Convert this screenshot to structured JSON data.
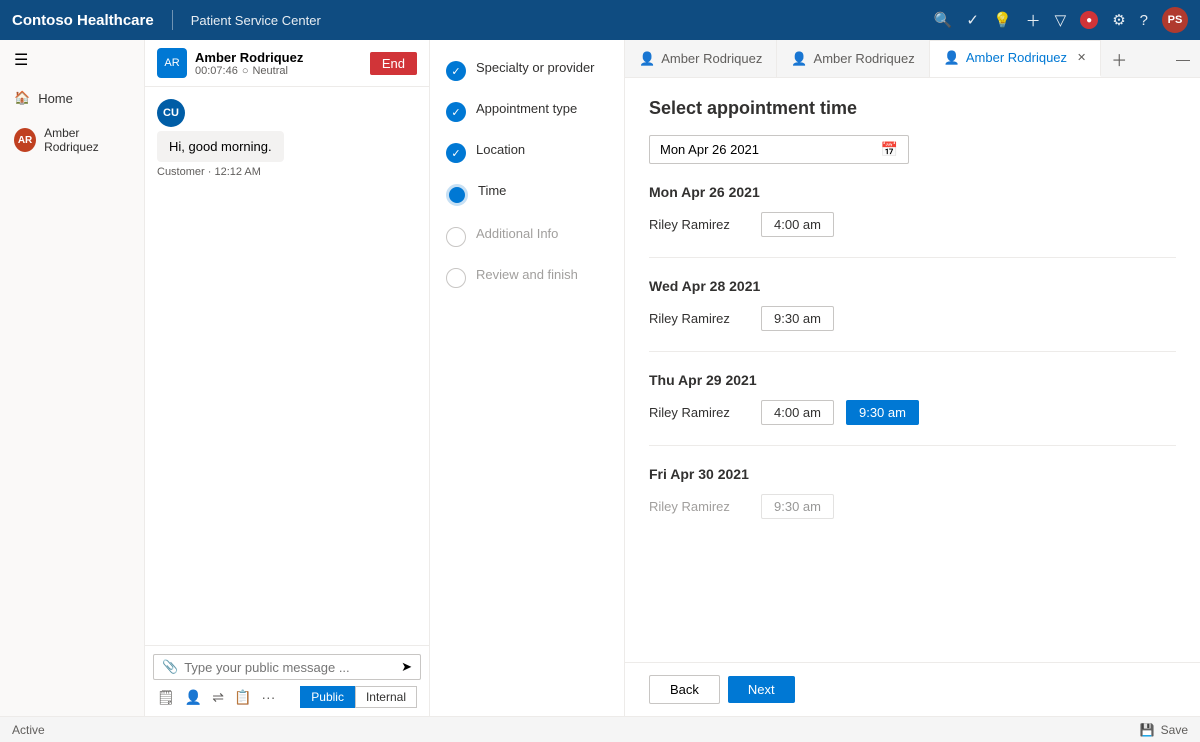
{
  "topbar": {
    "logo": "Contoso Healthcare",
    "subtitle": "Patient Service Center",
    "icons": [
      "search",
      "check-circle",
      "lightbulb",
      "plus",
      "filter",
      "notification",
      "settings",
      "help"
    ],
    "avatar_label": "PS"
  },
  "sidebar": {
    "home_label": "Home",
    "user_label": "Amber Rodriquez",
    "user_initials": "AR"
  },
  "chat": {
    "agent_avatar": "AR",
    "agent_name": "Amber Rodriquez",
    "timer": "00:07:46",
    "status": "Neutral",
    "end_label": "End",
    "message_text": "Hi, good morning.",
    "message_sender": "Customer · 12:12 AM",
    "message_avatar": "CU",
    "input_placeholder": "Type your public message ...",
    "toggle_public": "Public",
    "toggle_internal": "Internal"
  },
  "steps": [
    {
      "label": "Specialty or provider",
      "state": "completed"
    },
    {
      "label": "Appointment type",
      "state": "completed"
    },
    {
      "label": "Location",
      "state": "completed"
    },
    {
      "label": "Time",
      "state": "active"
    },
    {
      "label": "Additional Info",
      "state": "inactive"
    },
    {
      "label": "Review and finish",
      "state": "inactive"
    }
  ],
  "tabs": [
    {
      "label": "Amber Rodriquez",
      "icon": "person",
      "active": false,
      "closeable": false
    },
    {
      "label": "Amber Rodriquez",
      "icon": "person",
      "active": false,
      "closeable": false
    },
    {
      "label": "Amber Rodriquez",
      "icon": "person",
      "active": true,
      "closeable": true
    }
  ],
  "appointment": {
    "title": "Select appointment time",
    "date_value": "Mon Apr 26 2021",
    "date_placeholder": "Mon Apr 26 2021",
    "sections": [
      {
        "date_label": "Mon Apr 26 2021",
        "rows": [
          {
            "provider": "Riley Ramirez",
            "times": [
              {
                "label": "4:00 am",
                "selected": false
              }
            ]
          }
        ]
      },
      {
        "date_label": "Wed Apr 28 2021",
        "rows": [
          {
            "provider": "Riley Ramirez",
            "times": [
              {
                "label": "9:30 am",
                "selected": false
              }
            ]
          }
        ]
      },
      {
        "date_label": "Thu Apr 29 2021",
        "rows": [
          {
            "provider": "Riley Ramirez",
            "times": [
              {
                "label": "4:00 am",
                "selected": false
              },
              {
                "label": "9:30 am",
                "selected": true
              }
            ]
          }
        ]
      },
      {
        "date_label": "Fri Apr 30 2021",
        "rows": [
          {
            "provider": "Riley Ramirez",
            "times": [
              {
                "label": "9:30 am",
                "selected": false
              }
            ]
          }
        ]
      }
    ],
    "back_label": "Back",
    "next_label": "Next"
  },
  "statusbar": {
    "status": "Active",
    "save_label": "Save"
  }
}
